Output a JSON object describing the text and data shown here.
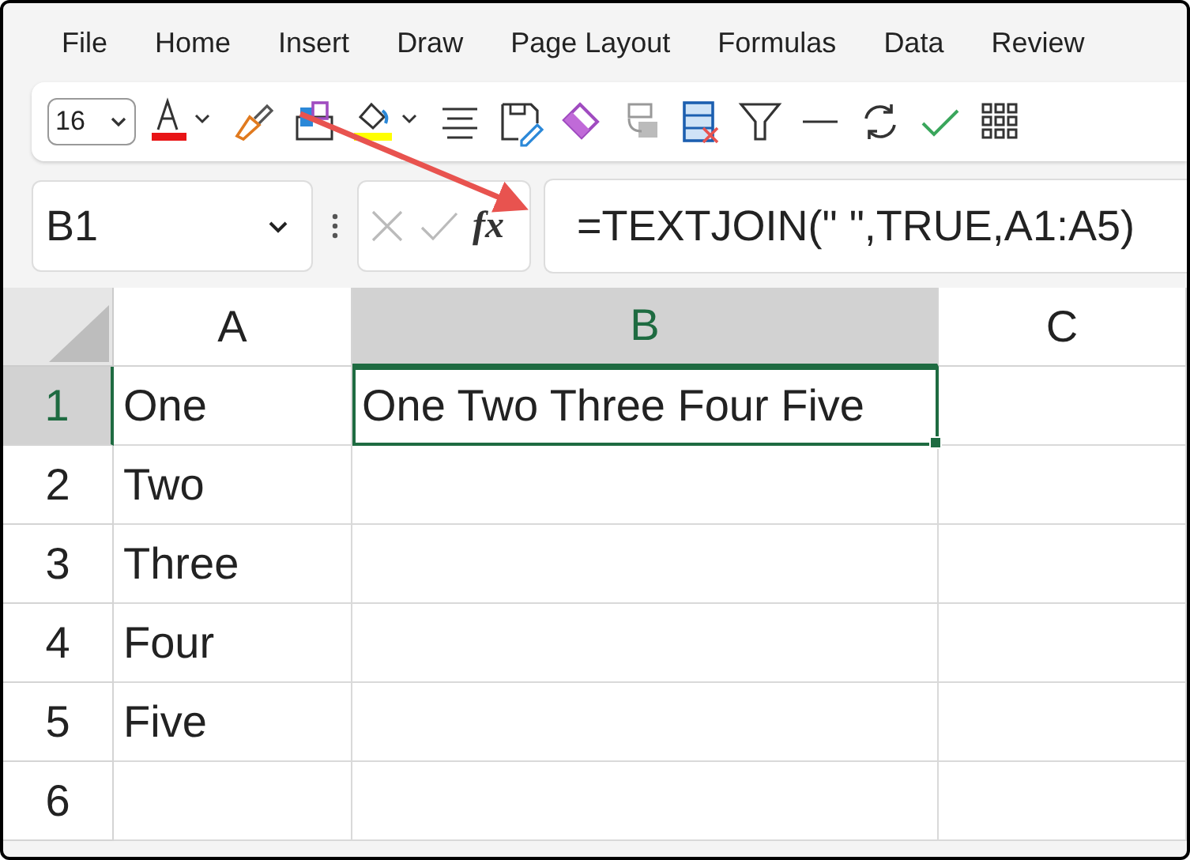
{
  "menu": [
    {
      "label": "File"
    },
    {
      "label": "Home"
    },
    {
      "label": "Insert"
    },
    {
      "label": "Draw"
    },
    {
      "label": "Page Layout"
    },
    {
      "label": "Formulas"
    },
    {
      "label": "Data"
    },
    {
      "label": "Review"
    }
  ],
  "toolbar": {
    "font_size": "16"
  },
  "formula_bar": {
    "name_box": "B1",
    "fx": "fx",
    "formula": "=TEXTJOIN(\" \",TRUE,A1:A5)"
  },
  "sheet": {
    "columns": [
      {
        "label": "A",
        "selected": false
      },
      {
        "label": "B",
        "selected": true
      },
      {
        "label": "C",
        "selected": false
      }
    ],
    "rows": [
      {
        "label": "1",
        "selected": true,
        "cells": [
          "One",
          "One Two Three Four Five"
        ]
      },
      {
        "label": "2",
        "selected": false,
        "cells": [
          "Two"
        ]
      },
      {
        "label": "3",
        "selected": false,
        "cells": [
          "Three"
        ]
      },
      {
        "label": "4",
        "selected": false,
        "cells": [
          "Four"
        ]
      },
      {
        "label": "5",
        "selected": false,
        "cells": [
          "Five"
        ]
      },
      {
        "label": "6",
        "selected": false
      }
    ]
  }
}
